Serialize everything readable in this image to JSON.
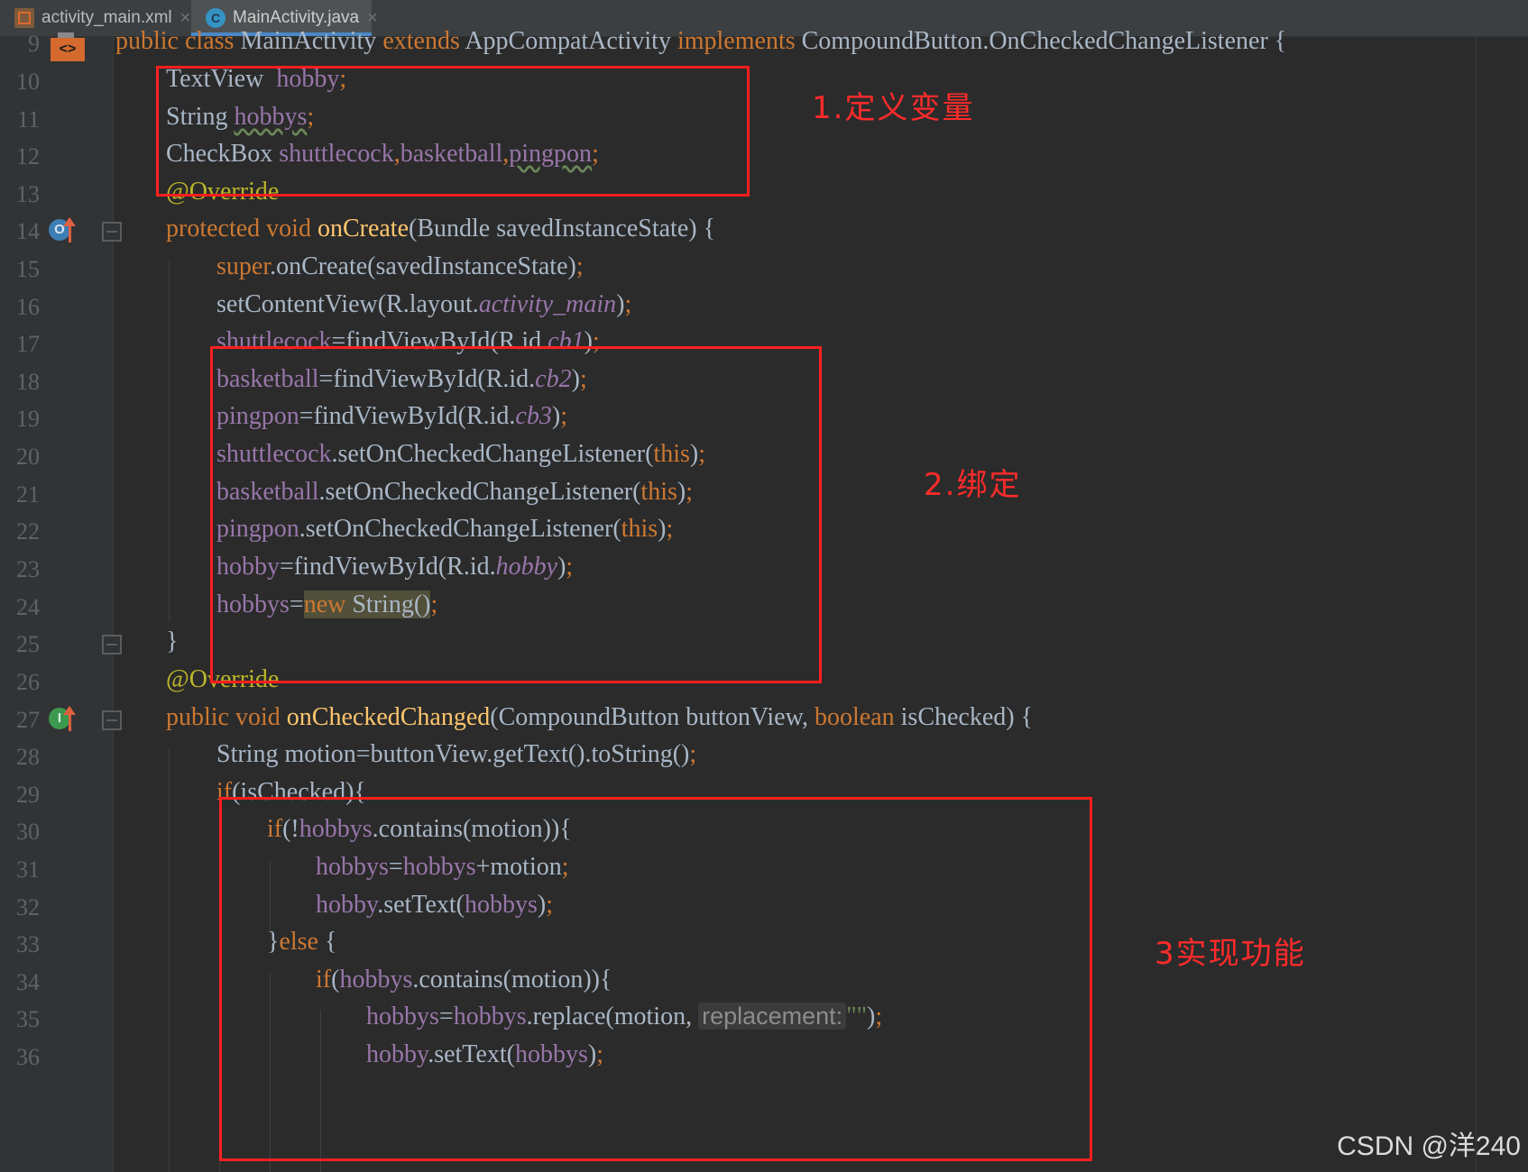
{
  "tabs": [
    {
      "label": "activity_main.xml",
      "icon": "xml-layout-icon"
    },
    {
      "label": "MainActivity.java",
      "icon": "java-class-icon",
      "active": true
    }
  ],
  "line_numbers": [
    "9",
    "10",
    "11",
    "12",
    "13",
    "14",
    "15",
    "16",
    "17",
    "18",
    "19",
    "20",
    "21",
    "22",
    "23",
    "24",
    "25",
    "26",
    "27",
    "28",
    "29",
    "30",
    "31",
    "32",
    "33",
    "34",
    "35",
    "36"
  ],
  "gutter_marks": {
    "override_badge": "O",
    "implements_badge": "I"
  },
  "code": {
    "l9": {
      "public": "public",
      "class": "class",
      "name": "MainActivity",
      "extends": "extends",
      "super": "AppCompatActivity",
      "implements": "implements",
      "iface": "CompoundButton.OnCheckedChangeListener",
      "brace": "{"
    },
    "l10": {
      "type": "TextView",
      "name": "hobby",
      "semi": ";"
    },
    "l11": {
      "type": "String",
      "name": "hobbys",
      "semi": ";"
    },
    "l12": {
      "type": "CheckBox",
      "a": "shuttlecock",
      "b": "basketball",
      "c": "pingpon",
      "comma": ",",
      "semi": ";"
    },
    "l13": {
      "text": "@Override"
    },
    "l14": {
      "mod": "protected",
      "void": "void",
      "meth": "onCreate",
      "params": "(Bundle savedInstanceState)",
      "brace": "{"
    },
    "l15": {
      "super": "super",
      "rest": ".onCreate(savedInstanceState)",
      "semi": ";"
    },
    "l16": {
      "pre": "setContentView(R.layout.",
      "ital": "activity_main",
      "post": ")",
      "semi": ";"
    },
    "l17": {
      "fld": "shuttlecock",
      "pre": "=findViewById(R.id.",
      "ital": "cb1",
      "post": ")",
      "semi": ";"
    },
    "l18": {
      "fld": "basketball",
      "pre": "=findViewById(R.id.",
      "ital": "cb2",
      "post": ")",
      "semi": ";"
    },
    "l19": {
      "fld": "pingpon",
      "pre": "=findViewById(R.id.",
      "ital": "cb3",
      "post": ")",
      "semi": ";"
    },
    "l20": {
      "fld": "shuttlecock",
      "pre": ".setOnCheckedChangeListener(",
      "kw": "this",
      "post": ")",
      "semi": ";"
    },
    "l21": {
      "fld": "basketball",
      "pre": ".setOnCheckedChangeListener(",
      "kw": "this",
      "post": ")",
      "semi": ";"
    },
    "l22": {
      "fld": "pingpon",
      "pre": ".setOnCheckedChangeListener(",
      "kw": "this",
      "post": ")",
      "semi": ";"
    },
    "l23": {
      "fld": "hobby",
      "pre": "=findViewById(R.id.",
      "ital": "hobby",
      "post": ")",
      "semi": ";"
    },
    "l24": {
      "fld": "hobbys",
      "eq": "=",
      "kw": "new",
      "rest": " String()",
      "semi": ";"
    },
    "l25": {
      "text": "}"
    },
    "l26": {
      "text": "@Override"
    },
    "l27": {
      "mod": "public",
      "void": "void",
      "meth": "onCheckedChanged",
      "p1": "(CompoundButton buttonView, ",
      "bool": "boolean",
      "p2": " isChecked)",
      "brace": "{"
    },
    "l28": {
      "text": "String motion=buttonView.getText().toString()",
      "semi": ";"
    },
    "l29": {
      "kw": "if",
      "rest": "(isChecked){"
    },
    "l30": {
      "kw": "if",
      "pre": "(!",
      "fld": "hobbys",
      "rest": ".contains(motion)){"
    },
    "l31": {
      "fld": "hobbys",
      "eq": "=",
      "fld2": "hobbys",
      "rest": "+motion",
      "semi": ";"
    },
    "l32": {
      "fld": "hobby",
      "pre": ".setText(",
      "fld2": "hobbys",
      "post": ")",
      "semi": ";"
    },
    "l33": {
      "pre": "}",
      "kw": "else",
      "rest": " {"
    },
    "l34": {
      "kw": "if",
      "pre": "(",
      "fld": "hobbys",
      "rest": ".contains(motion)){"
    },
    "l35": {
      "fld": "hobbys",
      "eq": "=",
      "fld2": "hobbys",
      "pre": ".replace(motion, ",
      "hint": "replacement:",
      "str": "\"\"",
      "post": ")",
      "semi": ";"
    },
    "l36": {
      "fld": "hobby",
      "pre": ".setText(",
      "fld2": "hobbys",
      "post": ")",
      "semi": ";"
    }
  },
  "annotations": {
    "note1": "1.定义变量",
    "note2": "2.绑定",
    "note3": "3实现功能"
  },
  "watermark": "CSDN @洋240",
  "colors": {
    "background": "#2b2b2b",
    "keyword": "#cc7832",
    "field": "#9876aa",
    "annotation": "#bbb529",
    "method": "#ffc66d",
    "text": "#a9b7c6",
    "red_box": "#ff1f1f"
  }
}
